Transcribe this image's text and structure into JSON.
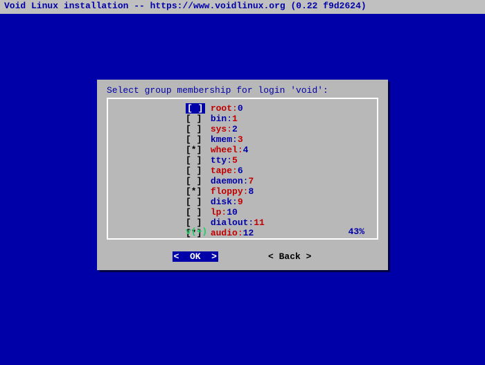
{
  "title_bar": "Void Linux installation -- https://www.voidlinux.org (0.22 f9d2624)",
  "dialog": {
    "prompt": "Select group membership for login 'void':",
    "scroll_arrow": "v(+)",
    "scroll_percent": "43%",
    "groups": [
      {
        "checked": false,
        "highlight": true,
        "name": "root",
        "gid": "0",
        "name_color": "#c00000",
        "gid_color": "#0000a8"
      },
      {
        "checked": false,
        "highlight": false,
        "name": "bin",
        "gid": "1",
        "name_color": "#0000a8",
        "gid_color": "#c00000"
      },
      {
        "checked": false,
        "highlight": false,
        "name": "sys",
        "gid": "2",
        "name_color": "#c00000",
        "gid_color": "#0000a8"
      },
      {
        "checked": false,
        "highlight": false,
        "name": "kmem",
        "gid": "3",
        "name_color": "#0000a8",
        "gid_color": "#c00000"
      },
      {
        "checked": true,
        "highlight": false,
        "name": "wheel",
        "gid": "4",
        "name_color": "#c00000",
        "gid_color": "#0000a8"
      },
      {
        "checked": false,
        "highlight": false,
        "name": "tty",
        "gid": "5",
        "name_color": "#0000a8",
        "gid_color": "#c00000"
      },
      {
        "checked": false,
        "highlight": false,
        "name": "tape",
        "gid": "6",
        "name_color": "#c00000",
        "gid_color": "#0000a8"
      },
      {
        "checked": false,
        "highlight": false,
        "name": "daemon",
        "gid": "7",
        "name_color": "#0000a8",
        "gid_color": "#c00000"
      },
      {
        "checked": true,
        "highlight": false,
        "name": "floppy",
        "gid": "8",
        "name_color": "#c00000",
        "gid_color": "#0000a8"
      },
      {
        "checked": false,
        "highlight": false,
        "name": "disk",
        "gid": "9",
        "name_color": "#0000a8",
        "gid_color": "#c00000"
      },
      {
        "checked": false,
        "highlight": false,
        "name": "lp",
        "gid": "10",
        "name_color": "#c00000",
        "gid_color": "#0000a8"
      },
      {
        "checked": false,
        "highlight": false,
        "name": "dialout",
        "gid": "11",
        "name_color": "#0000a8",
        "gid_color": "#c00000"
      },
      {
        "checked": true,
        "highlight": false,
        "name": "audio",
        "gid": "12",
        "name_color": "#c00000",
        "gid_color": "#0000a8"
      }
    ]
  },
  "buttons": {
    "ok": "<  OK  >",
    "back": "< Back >"
  }
}
